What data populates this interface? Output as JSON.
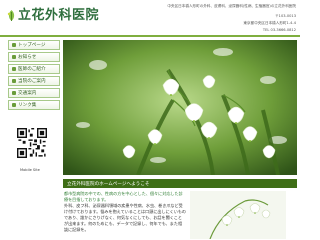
{
  "header": {
    "title": "立花外科医院",
    "tagline": "中央区日本橋人形町の外科、皮膚科、泌尿器科(性病、生殖器官)の立花外科医院",
    "postal": "〒103-0013",
    "address": "東京都中央区日本橋人形町1-4-4",
    "tel": "TEL 03-3666-0812"
  },
  "nav": {
    "items": [
      {
        "label": "トップページ"
      },
      {
        "label": "お知らせ"
      },
      {
        "label": "医師のご紹介"
      },
      {
        "label": "当院のご案内"
      },
      {
        "label": "交通案内"
      },
      {
        "label": "リンク集"
      }
    ]
  },
  "sidebar": {
    "mobile_label": "Mobile Site"
  },
  "welcome": {
    "heading": "立花外科医院のホームページへようこそ"
  },
  "intro": {
    "lead": "都市型病院の中での、性病の方を中心とした、個々に対応した診療を目指しております。",
    "body": "外科、皮フ科、泌尿器科領域の疾患や性病、水虫、巻き爪など受け付けております。悩みを抱えていることは口頭に出しにくいものであり、誰かにさりげなく、何気なくにしても、お話を聞くことが出来ます。何のためにも、データで記録し、何年でも、また相談に記録を。"
  },
  "colors": {
    "brand_green": "#2f6f3e",
    "nav_border": "#a8c98a",
    "welcome_bar": "#3e6e16"
  }
}
